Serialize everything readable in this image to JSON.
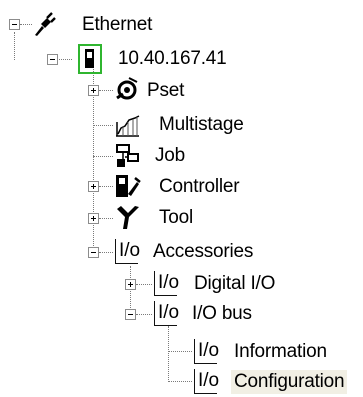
{
  "tree": {
    "ethernet": {
      "label": "Ethernet",
      "expanded": true
    },
    "controller_node": {
      "label": "10.40.167.41",
      "expanded": true
    },
    "pset": {
      "label": "Pset",
      "expanded": false
    },
    "multistage": {
      "label": "Multistage"
    },
    "job": {
      "label": "Job"
    },
    "controller": {
      "label": "Controller",
      "expanded": false
    },
    "tool": {
      "label": "Tool",
      "expanded": false
    },
    "accessories": {
      "label": "Accessories",
      "expanded": true
    },
    "digital_io": {
      "label": "Digital I/O",
      "expanded": false
    },
    "io_bus": {
      "label": "I/O bus",
      "expanded": true
    },
    "information": {
      "label": "Information"
    },
    "configuration": {
      "label": "Configuration",
      "selected": true
    }
  },
  "icon_glyphs": {
    "io": "I/o"
  },
  "colors": {
    "selection_bg": "#f1efe4",
    "controller_border": "#2fb52f",
    "connector": "#7a7a7a"
  }
}
